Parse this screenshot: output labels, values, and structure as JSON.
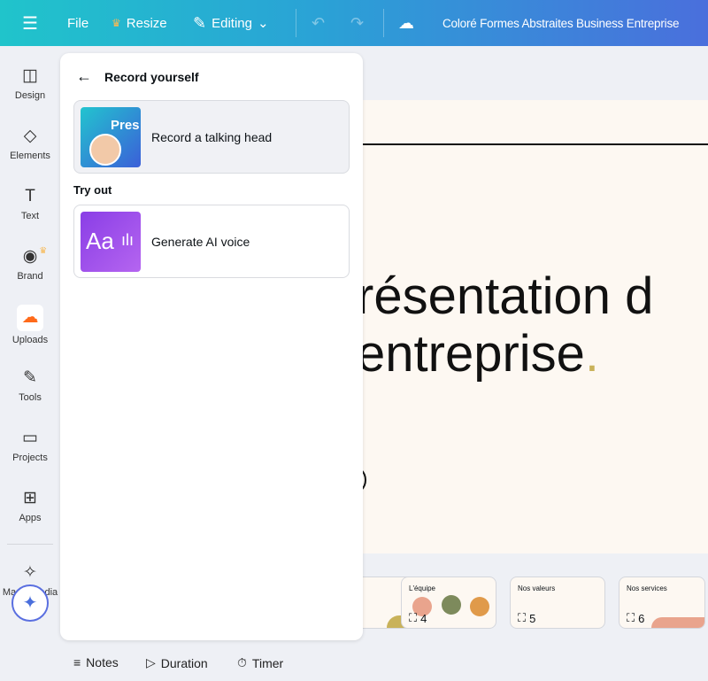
{
  "topbar": {
    "file": "File",
    "resize": "Resize",
    "editing": "Editing",
    "title": "Coloré Formes Abstraites Business Entreprise"
  },
  "sidebar": {
    "items": [
      {
        "label": "Design"
      },
      {
        "label": "Elements"
      },
      {
        "label": "Text"
      },
      {
        "label": "Brand"
      },
      {
        "label": "Uploads"
      },
      {
        "label": "Tools"
      },
      {
        "label": "Projects"
      },
      {
        "label": "Apps"
      },
      {
        "label": "Magic Media"
      }
    ]
  },
  "panel": {
    "title": "Record yourself",
    "record_label": "Record a talking head",
    "record_thumb_text": "Pres",
    "section": "Try out",
    "voice_label": "Generate AI voice",
    "voice_thumb_text": "Aa"
  },
  "slide": {
    "line1": "résentation d",
    "line2": "entreprise",
    "dot": "."
  },
  "thumbnails": [
    {
      "title": "",
      "num": ""
    },
    {
      "title": "L'équipe",
      "num": "4"
    },
    {
      "title": "Nos valeurs",
      "num": "5"
    },
    {
      "title": "Nos services",
      "num": "6"
    }
  ],
  "bottom": {
    "notes": "Notes",
    "duration": "Duration",
    "timer": "Timer"
  },
  "colors": {
    "accent": "#c9b25a",
    "uploads": "#ff6a1a"
  }
}
